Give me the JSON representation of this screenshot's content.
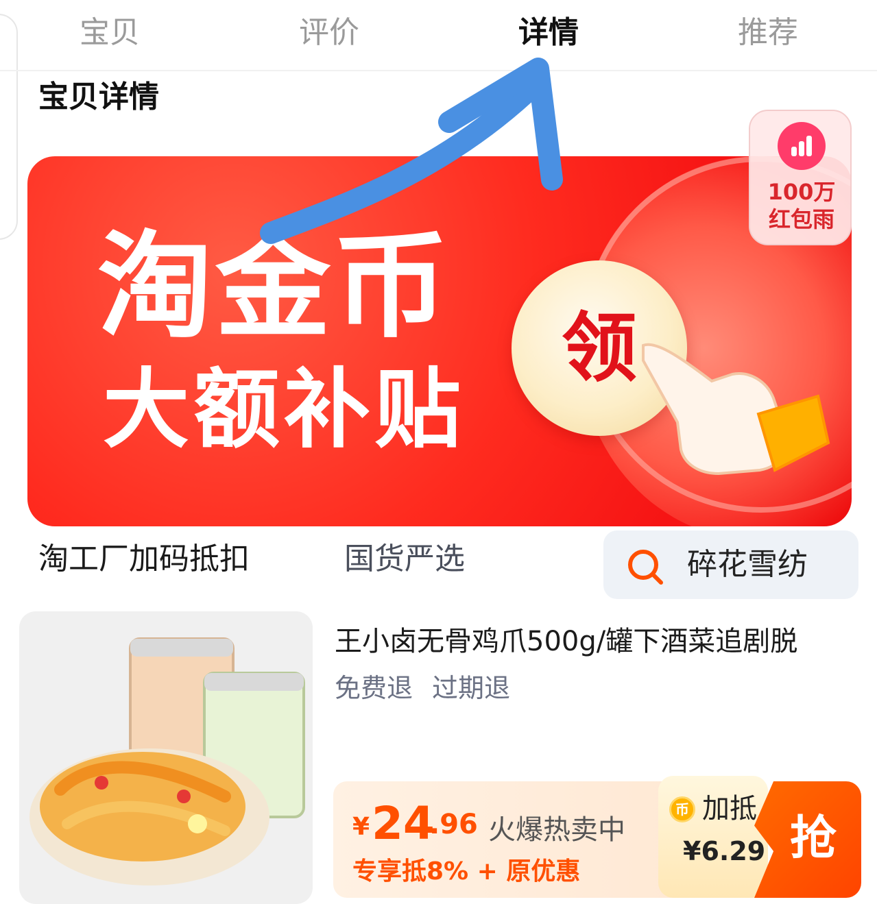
{
  "tabs": [
    {
      "label": "宝贝",
      "active": false
    },
    {
      "label": "评价",
      "active": false
    },
    {
      "label": "详情",
      "active": true
    },
    {
      "label": "推荐",
      "active": false
    }
  ],
  "section_title": "宝贝详情",
  "banner": {
    "line1": "淘金币",
    "line2": "大额补贴",
    "claim_label": "领"
  },
  "rain_badge": {
    "line1": "100万",
    "line2": "红包雨"
  },
  "links": {
    "factory": "淘工厂加码抵扣",
    "guohuo": "国货严选"
  },
  "search": {
    "query": "碎花雪纺"
  },
  "product": {
    "title": "王小卤无骨鸡爪500g/罐下酒菜追剧脱",
    "tags": [
      "免费退",
      "过期退"
    ],
    "price": {
      "currency": "¥",
      "integer": "24",
      "decimal": ".96"
    },
    "hot_text": "火爆热卖中",
    "discount_text": "专享抵8% + 原优惠",
    "subsidy": {
      "label": "加抵",
      "value": "¥6.29"
    },
    "grab_label": "抢"
  },
  "colors": {
    "accent": "#ff5000",
    "banner_red": "#f61414",
    "arrow_blue": "#4a90e2"
  }
}
